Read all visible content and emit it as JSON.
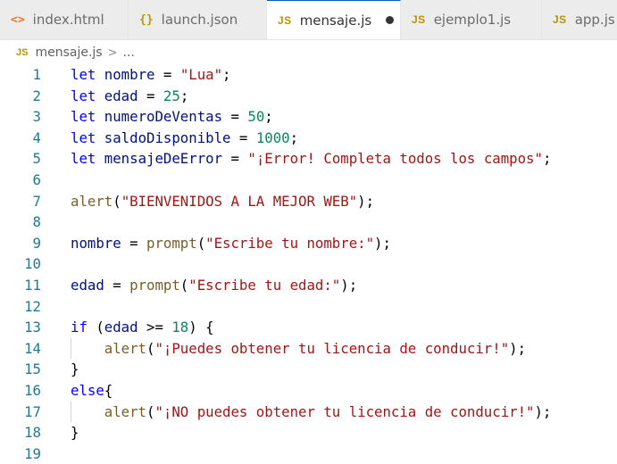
{
  "tabs": [
    {
      "icon": "<>",
      "icon_kind": "html",
      "label": "index.html",
      "active": false,
      "modified": false
    },
    {
      "icon": "{}",
      "icon_kind": "json",
      "label": "launch.json",
      "active": false,
      "modified": false
    },
    {
      "icon": "JS",
      "icon_kind": "js",
      "label": "mensaje.js",
      "active": true,
      "modified": true
    },
    {
      "icon": "JS",
      "icon_kind": "js",
      "label": "ejemplo1.js",
      "active": false,
      "modified": false
    },
    {
      "icon": "JS",
      "icon_kind": "js",
      "label": "app.js",
      "active": false,
      "modified": false
    }
  ],
  "breadcrumb": {
    "icon": "JS",
    "file": "mensaje.js",
    "separator": ">",
    "rest": "..."
  },
  "colors": {
    "keyword": "#0000ff",
    "variable": "#001080",
    "string": "#a31515",
    "number": "#098658",
    "function": "#795e26",
    "line_number": "#237893"
  },
  "lines": [
    {
      "num": "1",
      "tokens": [
        [
          "kw",
          "let"
        ],
        [
          "pun",
          " "
        ],
        [
          "var",
          "nombre"
        ],
        [
          "pun",
          " = "
        ],
        [
          "str",
          "\"Lua\""
        ],
        [
          "pun",
          ";"
        ]
      ]
    },
    {
      "num": "2",
      "tokens": [
        [
          "kw",
          "let"
        ],
        [
          "pun",
          " "
        ],
        [
          "var",
          "edad"
        ],
        [
          "pun",
          " = "
        ],
        [
          "num",
          "25"
        ],
        [
          "pun",
          ";"
        ]
      ]
    },
    {
      "num": "3",
      "tokens": [
        [
          "kw",
          "let"
        ],
        [
          "pun",
          " "
        ],
        [
          "var",
          "numeroDeVentas"
        ],
        [
          "pun",
          " = "
        ],
        [
          "num",
          "50"
        ],
        [
          "pun",
          ";"
        ]
      ]
    },
    {
      "num": "4",
      "tokens": [
        [
          "kw",
          "let"
        ],
        [
          "pun",
          " "
        ],
        [
          "var",
          "saldoDisponible"
        ],
        [
          "pun",
          " = "
        ],
        [
          "num",
          "1000"
        ],
        [
          "pun",
          ";"
        ]
      ]
    },
    {
      "num": "5",
      "tokens": [
        [
          "kw",
          "let"
        ],
        [
          "pun",
          " "
        ],
        [
          "var",
          "mensajeDeError"
        ],
        [
          "pun",
          " = "
        ],
        [
          "str",
          "\"¡Error! Completa todos los campos\""
        ],
        [
          "pun",
          ";"
        ]
      ]
    },
    {
      "num": "6",
      "tokens": []
    },
    {
      "num": "7",
      "tokens": [
        [
          "fn",
          "alert"
        ],
        [
          "pun",
          "("
        ],
        [
          "str",
          "\"BIENVENIDOS A LA MEJOR WEB\""
        ],
        [
          "pun",
          ");"
        ]
      ]
    },
    {
      "num": "8",
      "tokens": []
    },
    {
      "num": "9",
      "tokens": [
        [
          "var",
          "nombre"
        ],
        [
          "pun",
          " = "
        ],
        [
          "fn",
          "prompt"
        ],
        [
          "pun",
          "("
        ],
        [
          "str",
          "\"Escribe tu nombre:\""
        ],
        [
          "pun",
          ");"
        ]
      ]
    },
    {
      "num": "10",
      "tokens": []
    },
    {
      "num": "11",
      "tokens": [
        [
          "var",
          "edad"
        ],
        [
          "pun",
          " = "
        ],
        [
          "fn",
          "prompt"
        ],
        [
          "pun",
          "("
        ],
        [
          "str",
          "\"Escribe tu edad:\""
        ],
        [
          "pun",
          ");"
        ]
      ]
    },
    {
      "num": "12",
      "tokens": []
    },
    {
      "num": "13",
      "tokens": [
        [
          "kw",
          "if"
        ],
        [
          "pun",
          " ("
        ],
        [
          "var",
          "edad"
        ],
        [
          "pun",
          " >= "
        ],
        [
          "num",
          "18"
        ],
        [
          "pun",
          ") {"
        ]
      ]
    },
    {
      "num": "14",
      "guide": true,
      "tokens": [
        [
          "pun",
          "    "
        ],
        [
          "fn",
          "alert"
        ],
        [
          "pun",
          "("
        ],
        [
          "str",
          "\"¡Puedes obtener tu licencia de conducir!\""
        ],
        [
          "pun",
          ");"
        ]
      ]
    },
    {
      "num": "15",
      "tokens": [
        [
          "pun",
          "}"
        ]
      ]
    },
    {
      "num": "16",
      "tokens": [
        [
          "kw",
          "else"
        ],
        [
          "pun",
          "{"
        ]
      ]
    },
    {
      "num": "17",
      "guide": true,
      "tokens": [
        [
          "pun",
          "    "
        ],
        [
          "fn",
          "alert"
        ],
        [
          "pun",
          "("
        ],
        [
          "str",
          "\"¡NO puedes obtener tu licencia de conducir!\""
        ],
        [
          "pun",
          ");"
        ]
      ]
    },
    {
      "num": "18",
      "tokens": [
        [
          "pun",
          "}"
        ]
      ]
    },
    {
      "num": "19",
      "tokens": []
    }
  ]
}
